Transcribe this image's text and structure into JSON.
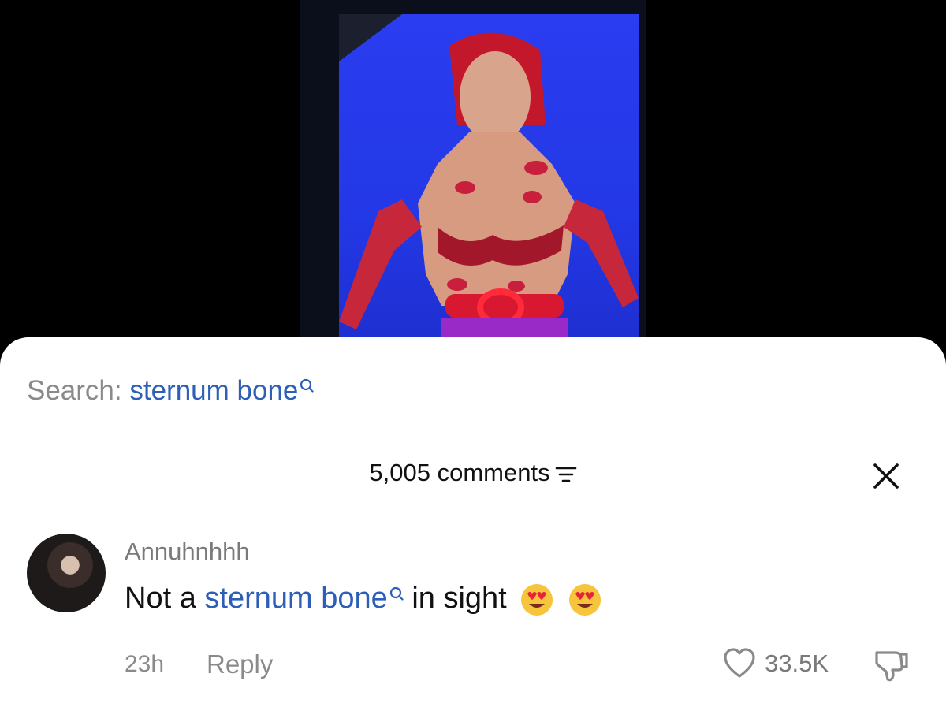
{
  "video": {
    "background_color": "#000000",
    "screen_color": "#2338e6"
  },
  "search": {
    "prefix": "Search: ",
    "term": "sternum bone",
    "icon": "search-icon"
  },
  "comments_header": {
    "count_label": "5,005 comments",
    "filter_icon": "filter-icon",
    "close_icon": "close-icon"
  },
  "comment": {
    "username": "Annuhnhhh",
    "text_before": "Not a ",
    "text_link": "sternum bone",
    "text_after": " in sight",
    "emojis": [
      "heart-eyes-emoji",
      "heart-eyes-emoji"
    ],
    "time": "23h",
    "reply_label": "Reply",
    "like_count": "33.5K",
    "like_icon": "heart-outline-icon",
    "dislike_icon": "thumbs-down-icon"
  },
  "colors": {
    "link": "#2d5fb8",
    "muted": "#8a8a8a",
    "text": "#111111"
  }
}
